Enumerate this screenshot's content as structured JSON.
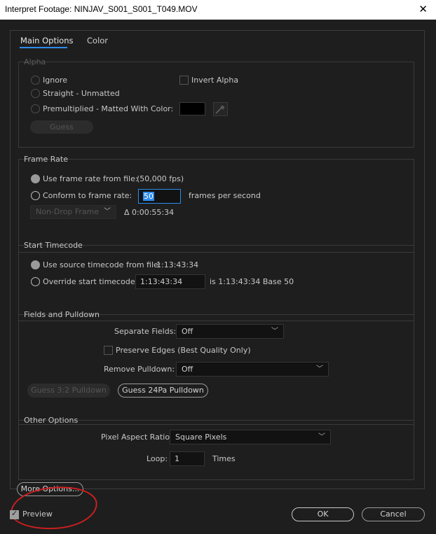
{
  "window": {
    "title": "Interpret Footage: NINJAV_S001_S001_T049.MOV"
  },
  "tabs": [
    {
      "label": "Main Options"
    },
    {
      "label": "Color"
    }
  ],
  "alpha": {
    "label": "Alpha",
    "ignore": "Ignore",
    "straight": "Straight - Unmatted",
    "premultiplied": "Premultiplied - Matted With Color:",
    "invert": "Invert Alpha",
    "guess": "Guess",
    "matte_color": "#000000"
  },
  "frame_rate": {
    "label": "Frame Rate",
    "use_file": "Use frame rate from file:",
    "file_fps": "(50,000 fps)",
    "conform": "Conform to frame rate:",
    "conform_value": "50",
    "fps_unit": "frames per second",
    "drop_frame": "Non-Drop Frame",
    "duration": "Δ 0:00:55:34"
  },
  "timecode": {
    "label": "Start Timecode",
    "use_source": "Use source timecode from file:",
    "source_value": "1:13:43:34",
    "override": "Override start timecode:",
    "override_value": "1:13:43:34",
    "is_text": "is 1:13:43:34  Base 50"
  },
  "fields": {
    "label": "Fields and Pulldown",
    "separate_label": "Separate Fields:",
    "separate_value": "Off",
    "preserve": "Preserve Edges (Best Quality Only)",
    "remove_label": "Remove Pulldown:",
    "remove_value": "Off",
    "guess32": "Guess 3:2 Pulldown",
    "guess24": "Guess 24Pa Pulldown"
  },
  "other": {
    "label": "Other Options",
    "par_label": "Pixel Aspect Ratio:",
    "par_value": "Square Pixels",
    "loop_label": "Loop:",
    "loop_value": "1",
    "times": "Times"
  },
  "footer": {
    "more_options": "More Options...",
    "preview": "Preview",
    "ok": "OK",
    "cancel": "Cancel"
  },
  "colors": {
    "accent": "#2d8ceb",
    "annotation": "#cc1f1f"
  },
  "icons": {
    "close": "close-icon",
    "eyedropper": "eyedropper-icon",
    "chevron": "chevron-down-icon"
  }
}
